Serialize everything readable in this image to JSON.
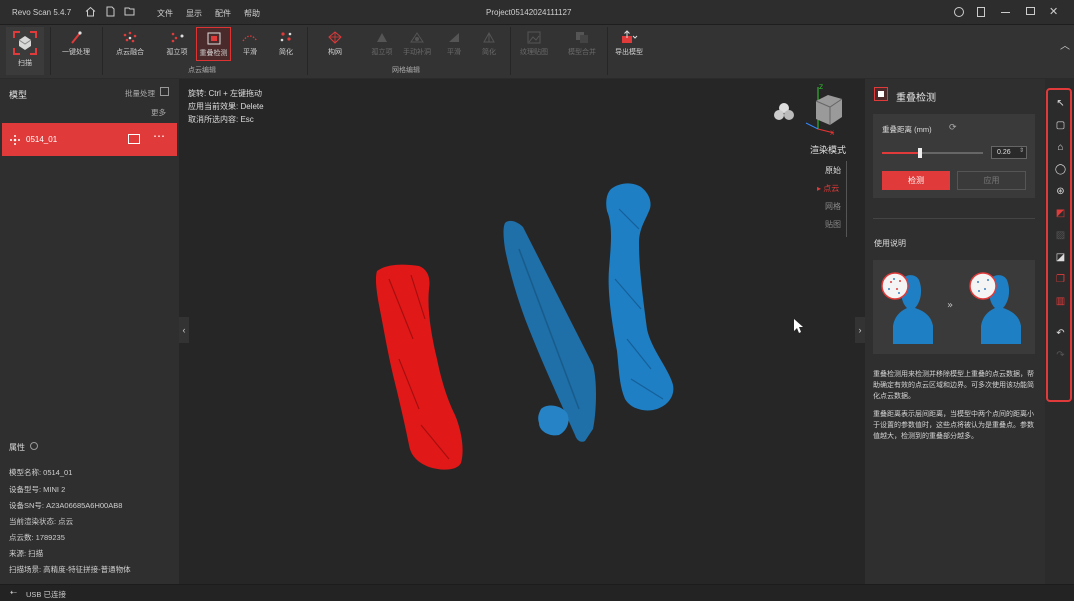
{
  "app": {
    "name": "Revo Scan 5.4.7",
    "project_title": "Project05142024111127"
  },
  "menu": [
    "文件",
    "显示",
    "配件",
    "帮助"
  ],
  "ribbon": {
    "scan": "扫描",
    "one_click": "一键处理",
    "groups": {
      "point_edit": "点云编辑",
      "mesh_edit": "网格编辑"
    },
    "point_tools": [
      "点云融合",
      "孤立项",
      "重叠检测",
      "平滑",
      "简化"
    ],
    "mesh_tools": [
      "构网",
      "孤立项",
      "手动补洞",
      "平滑",
      "简化"
    ],
    "texture": "纹理贴图",
    "merge": "模型合并",
    "export": "导出模型"
  },
  "left": {
    "models_title": "模型",
    "batch": "批量处理",
    "more": "更多",
    "model_item": "0514_01",
    "props_title": "属性",
    "props": [
      "模型名称: 0514_01",
      "设备型号: MINI 2",
      "设备SN号: A23A06685A6H00AB8",
      "当前渲染状态: 点云",
      "点云数: 1789235",
      "来源: 扫描",
      "扫描场景: 高精度-特征拼接-普通物体"
    ]
  },
  "viewport": {
    "hints": [
      "旋转: Ctrl + 左键拖动",
      "应用当前效果: Delete",
      "取消所选内容: Esc"
    ],
    "render_mode_title": "渲染模式",
    "render_modes": [
      "原始",
      "点云",
      "网格",
      "贴图"
    ],
    "active_render_mode": "点云"
  },
  "right": {
    "title": "重叠检测",
    "distance_label": "重叠距离 (mm)",
    "distance_value": "0.26",
    "distance_slider_fraction": 0.38,
    "detect_button": "检测",
    "apply_button": "应用",
    "usage_title": "使用说明",
    "desc1": "重叠检测用来检测并移除模型上重叠的点云数据，帮助确定有效的点云区域和边界。可多次使用该功能简化点云数据。",
    "desc2": "重叠距离表示层间距离，当模型中两个点间的距离小于设置的参数值时，这些点将被认为是重叠点。参数值越大，检测到的重叠部分越多。"
  },
  "status": {
    "usb": "USB 已连接"
  },
  "colors": {
    "accent": "#e03a3a",
    "model_red": "#e01818",
    "model_blue": "#1e7fc4",
    "model_blue_plate": "#1f6fa8"
  }
}
